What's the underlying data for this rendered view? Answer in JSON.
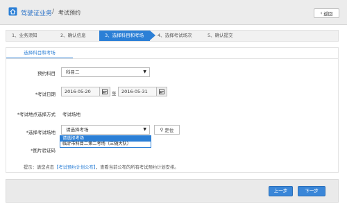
{
  "header": {
    "title": "驾驶证业务",
    "separator": "/",
    "current": "考试预约",
    "back_label": "返回"
  },
  "steps": [
    {
      "label": "1、业务须知",
      "active": false
    },
    {
      "label": "2、确认信息",
      "active": false
    },
    {
      "label": "3、选择科目和考场",
      "active": true
    },
    {
      "label": "4、选择考试场次",
      "active": false
    },
    {
      "label": "5、确认提交",
      "active": false
    }
  ],
  "panel": {
    "tab_label": "选择科目和考场"
  },
  "form": {
    "subject": {
      "label": "预约科目",
      "value": "科目二"
    },
    "date": {
      "label": "*考试日期",
      "start": "2016-05-20",
      "to": "至",
      "end": "2016-05-31"
    },
    "location_method": {
      "label": "*考试地点选择方式",
      "value": "考试场地"
    },
    "venue": {
      "label": "*选择考试场地",
      "value": "请选择考场",
      "locate_label": "定位",
      "options": [
        "请选择考场",
        "临沂市科目二第二考场（三随大队）"
      ],
      "selected_index": 0
    },
    "captcha": {
      "label": "*图片验证码"
    }
  },
  "hint": {
    "prefix": "提示：请您点击",
    "link": "【考试预约计划公布】",
    "suffix": "，查看当前公布的所有考试预约计划安排。"
  },
  "footer": {
    "prev_label": "上一步",
    "next_label": "下一步"
  },
  "colors": {
    "accent": "#2b7fd6",
    "header_bg": "#ececec"
  }
}
